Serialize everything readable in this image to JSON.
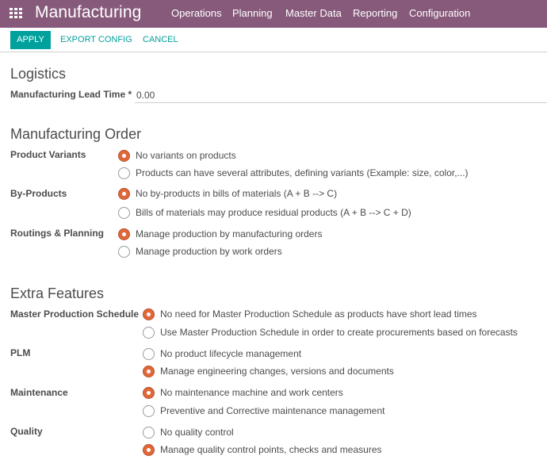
{
  "topbar": {
    "app_title": "Manufacturing",
    "menu": [
      "Operations",
      "Planning",
      "Master Data",
      "Reporting",
      "Configuration"
    ]
  },
  "controls": {
    "apply": "APPLY",
    "export": "EXPORT CONFIG",
    "cancel": "CANCEL"
  },
  "logistics": {
    "title": "Logistics",
    "lead_time_label": "Manufacturing Lead Time *",
    "lead_time_value": "0.00"
  },
  "manufacturing_order": {
    "title": "Manufacturing Order",
    "product_variants": {
      "label": "Product Variants",
      "options": [
        "No variants on products",
        "Products can have several attributes, defining variants (Example: size, color,...)"
      ],
      "selected": 0
    },
    "by_products": {
      "label": "By-Products",
      "options": [
        "No by-products in bills of materials (A + B --> C)",
        "Bills of materials may produce residual products (A + B --> C + D)"
      ],
      "selected": 0
    },
    "routings": {
      "label": "Routings & Planning",
      "options": [
        "Manage production by manufacturing orders",
        "Manage production by work orders"
      ],
      "selected": 0
    }
  },
  "extra_features": {
    "title": "Extra Features",
    "mps": {
      "label": "Master Production Schedule",
      "options": [
        "No need for Master Production Schedule as products have short lead times",
        "Use Master Production Schedule in order to create procurements based on forecasts"
      ],
      "selected": 0
    },
    "plm": {
      "label": "PLM",
      "options": [
        "No product lifecycle management",
        "Manage engineering changes, versions and documents"
      ],
      "selected": 1
    },
    "maintenance": {
      "label": "Maintenance",
      "options": [
        "No maintenance machine and work centers",
        "Preventive and Corrective maintenance management"
      ],
      "selected": 0
    },
    "quality": {
      "label": "Quality",
      "options": [
        "No quality control",
        "Manage quality control points, checks and measures"
      ],
      "selected": 1
    }
  },
  "colors": {
    "topbar": "#875a7b",
    "accent": "#00a09d",
    "radio_checked": "#e0683a"
  }
}
